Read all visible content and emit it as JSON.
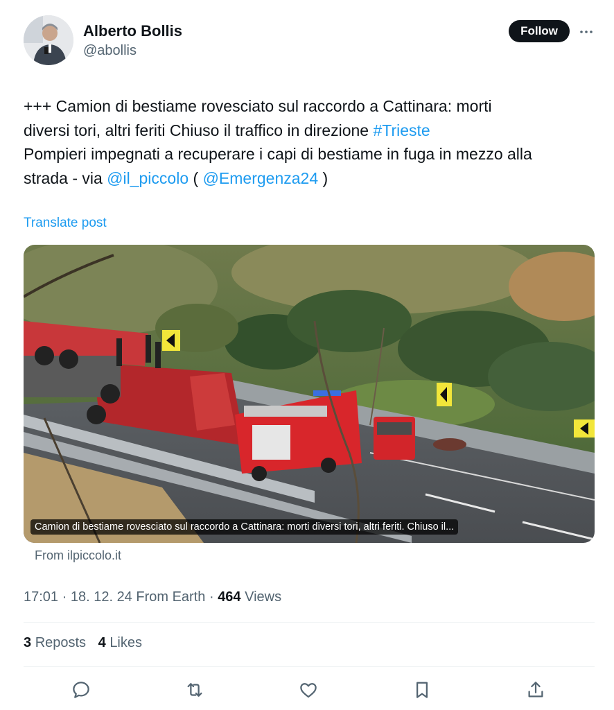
{
  "author": {
    "name": "Alberto Bollis",
    "handle": "@abollis"
  },
  "follow_label": "Follow",
  "icons": {
    "more": "more-horizontal-icon",
    "reply": "reply-icon",
    "repost": "repost-icon",
    "like": "like-icon",
    "bookmark": "bookmark-icon",
    "share": "share-icon"
  },
  "tweet": {
    "line1": "+++ Camion di bestiame rovesciato sul raccordo a Cattinara: morti",
    "line2_text": "diversi tori, altri feriti Chiuso il traffico in direzione ",
    "hashtag": "#Trieste",
    "line3": "Pompieri impegnati a recuperare i capi di bestiame in fuga in mezzo alla",
    "line4_text": "strada - via ",
    "mention1": "@il_piccolo",
    "paren_open": " ( ",
    "mention2": "@Emergenza24",
    "paren_close": " )"
  },
  "translate_label": "Translate post",
  "media": {
    "caption": "Camion di bestiame rovesciato sul raccordo a Cattinara: morti diversi tori, altri feriti. Chiuso il..."
  },
  "source_label": "From ilpiccolo.it",
  "meta": {
    "time": "17:01",
    "date": "18. 12. 24",
    "from": "From Earth",
    "views_count": "464",
    "views_label": "Views"
  },
  "stats": {
    "reposts_count": "3",
    "reposts_label": "Reposts",
    "likes_count": "4",
    "likes_label": "Likes"
  },
  "colors": {
    "link": "#1d9bf0",
    "text": "#0f1419",
    "muted": "#536471",
    "button_bg": "#0f1419"
  }
}
